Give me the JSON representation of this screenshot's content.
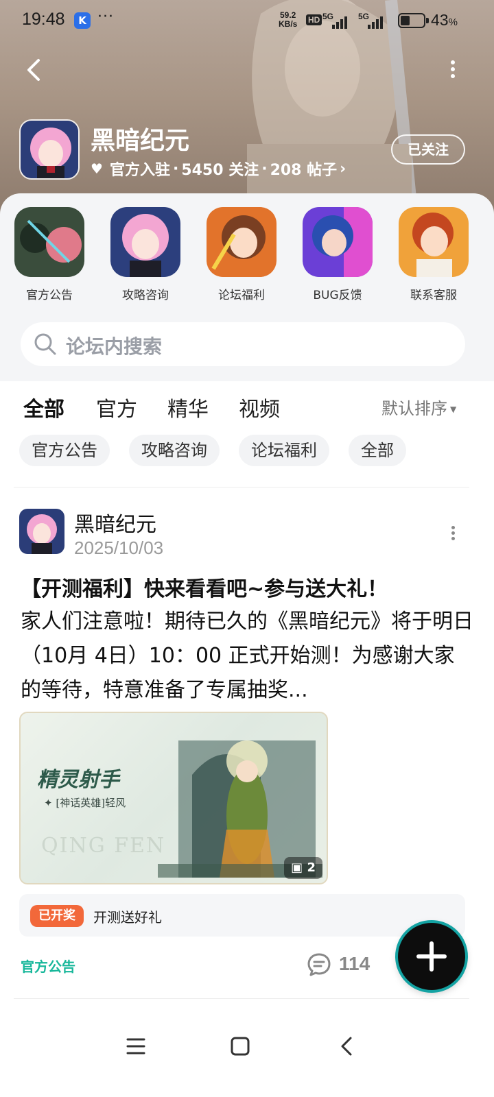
{
  "status_bar": {
    "time": "19:48",
    "app_badge": "K",
    "overflow": "···",
    "net_speed_value": "59.2",
    "net_speed_unit": "KB/s",
    "hd": "HD",
    "signal1": "5G",
    "signal2": "5G",
    "battery_percent": 43,
    "battery_label": "43",
    "battery_unit": "%"
  },
  "forum": {
    "name": "黑暗纪元",
    "verified": "官方入驻",
    "followers": "5450 关注",
    "posts": "208 帖子",
    "separator": "·",
    "follow_button": "已关注"
  },
  "shortcuts": [
    {
      "label": "官方公告"
    },
    {
      "label": "攻略咨询"
    },
    {
      "label": "论坛福利"
    },
    {
      "label": "BUG反馈"
    },
    {
      "label": "联系客服"
    }
  ],
  "search": {
    "placeholder": "论坛内搜索"
  },
  "tabs": [
    {
      "label": "全部",
      "active": true
    },
    {
      "label": "官方"
    },
    {
      "label": "精华"
    },
    {
      "label": "视频"
    }
  ],
  "sort": {
    "label": "默认排序"
  },
  "filters": [
    "官方公告",
    "攻略咨询",
    "论坛福利",
    "全部"
  ],
  "post": {
    "author": "黑暗纪元",
    "date": "2025/10/03",
    "title": "【开测福利】快来看看吧~参与送大礼！",
    "body": "家人们注意啦！期待已久的《黑暗纪元》将于明日（10月 4日）10：00 正式开始测！为感谢大家的等待，特意准备了专属抽奖...",
    "image": {
      "title": "精灵射手",
      "subtitle_tag": "[神话英雄]",
      "subtitle_name": "轻风",
      "watermark": "QING FEN",
      "count": "2"
    },
    "lottery_badge": "已开奖",
    "lottery_text": "开测送好礼",
    "tag": "官方公告",
    "comments": "114"
  },
  "colors": {
    "accent": "#20c5a8",
    "tag": "#17b79a",
    "lottery_badge": "#f2683a",
    "header": "#a89585"
  }
}
